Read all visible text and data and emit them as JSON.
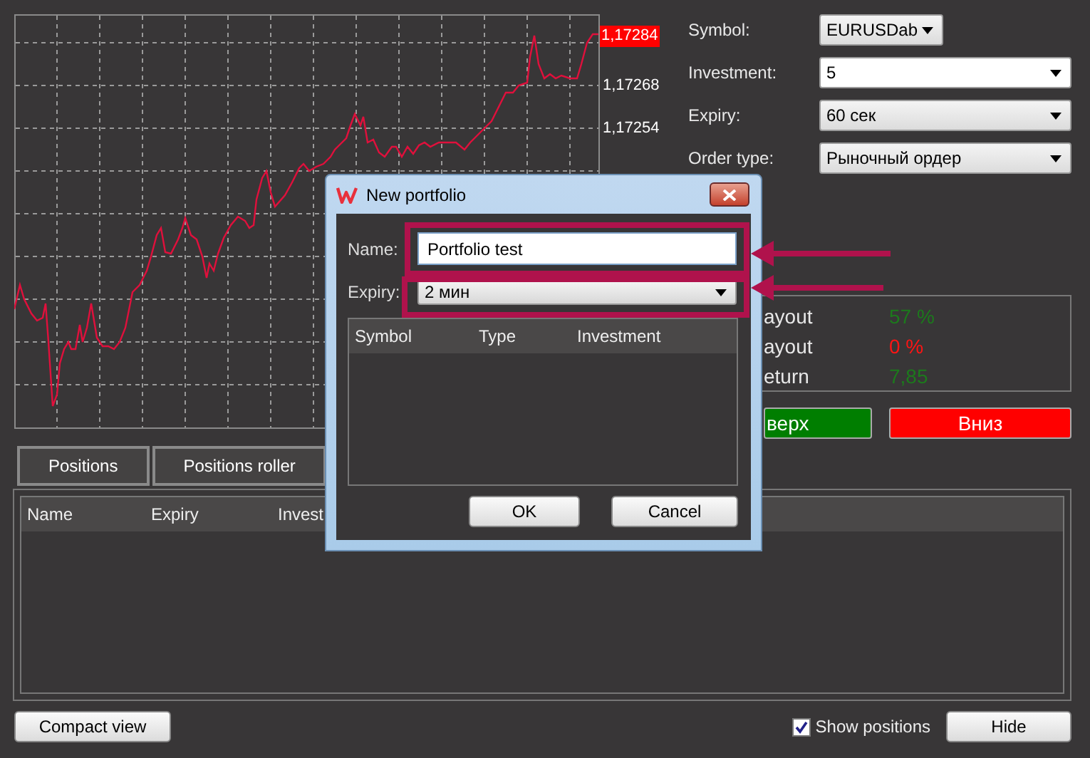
{
  "chart": {
    "price_tag": "1,17284",
    "axis_labels": [
      "1,17268",
      "1,17254"
    ]
  },
  "order_form": [
    {
      "label": "Symbol:",
      "value": "EURUSDab",
      "kind": "short-combo"
    },
    {
      "label": "Investment:",
      "value": "5",
      "kind": "editable-combo"
    },
    {
      "label": "Expiry:",
      "value": "60 сек",
      "kind": "combo"
    },
    {
      "label": "Order type:",
      "value": "Рыночный ордер",
      "kind": "combo"
    }
  ],
  "stats": [
    {
      "label": "ayout",
      "value": "57 %",
      "color": "#1c7a1c"
    },
    {
      "label": "ayout",
      "value": "0 %",
      "color": "#ff1414"
    },
    {
      "label": "eturn",
      "value": "7,85",
      "color": "#1c7a1c"
    }
  ],
  "trade_buttons": [
    {
      "label": "верх",
      "kind": "up"
    },
    {
      "label": "Вниз",
      "kind": "down"
    }
  ],
  "tabs": [
    {
      "label": "Positions",
      "selected": false
    },
    {
      "label": "Positions roller",
      "selected": false
    }
  ],
  "positions_table": {
    "columns": [
      "Name",
      "Expiry",
      "Invest"
    ]
  },
  "compact_button": "Compact view",
  "show_positions": {
    "label": "Show positions",
    "checked": true
  },
  "hide_button": "Hide",
  "dialog": {
    "title": "New portfolio",
    "name_label": "Name:",
    "name_value": "Portfolio test",
    "expiry_label": "Expiry:",
    "expiry_value": "2 мин",
    "columns": [
      "Symbol",
      "Type",
      "Investment"
    ],
    "buttons": [
      "OK",
      "Cancel"
    ]
  }
}
